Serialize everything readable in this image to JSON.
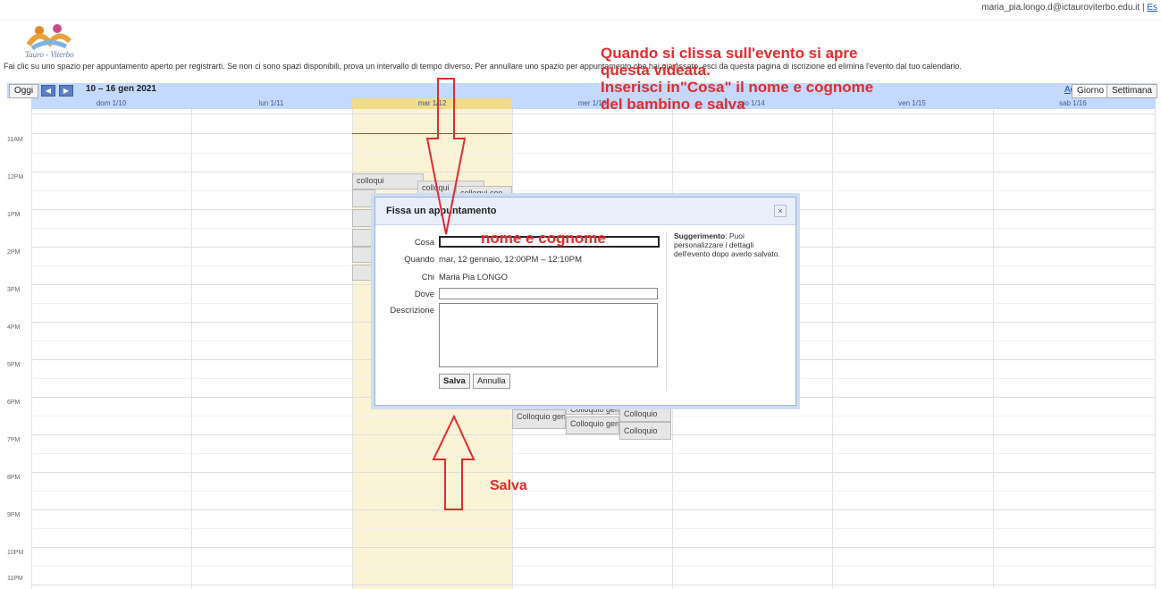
{
  "header": {
    "user_email": "maria_pia.longo.d@ictauroviterbo.edu.it",
    "separator": " | ",
    "exit_link": "Es"
  },
  "instructions": "Fai clic su uno spazio per appuntamento aperto per registrarti. Se non ci sono spazi disponibili, prova un intervallo di tempo diverso. Per annullare uno spazio per appuntamento che hai già fissato, esci da questa pagina di iscrizione ed elimina l'evento dal tuo calendario.",
  "toolbar": {
    "today": "Oggi",
    "prev": "◀",
    "next": "▶",
    "date_range": "10 – 16 gen 2021",
    "refresh": "Aggiorna",
    "view_day": "Giorno",
    "view_week": "Settimana"
  },
  "days": [
    "dom 1/10",
    "lun 1/11",
    "mar 1/12",
    "mer 1/13",
    "gio 1/14",
    "ven 1/15",
    "sab 1/16"
  ],
  "hours": [
    "11AM",
    "12PM",
    "1PM",
    "2PM",
    "3PM",
    "4PM",
    "5PM",
    "6PM",
    "7PM",
    "8PM",
    "9PM",
    "10PM",
    "11PM"
  ],
  "slots": {
    "s1": "colloqui",
    "s2": "colloqui",
    "s3": "colloqui con",
    "s4": "Colloquio gen",
    "s5": "Colloquio gen",
    "s6": "Colloquio gen",
    "s7": "Colloquio",
    "s8": "Colloquio"
  },
  "modal": {
    "title": "Fissa un appuntamento",
    "close": "×",
    "labels": {
      "what": "Cosa",
      "when": "Quando",
      "who": "Chi",
      "where": "Dove",
      "description": "Descrizione"
    },
    "when_value": "mar, 12 gennaio, 12:00PM – 12:10PM",
    "who_value": "Maria Pia LONGO",
    "hint_bold": "Suggerimento",
    "hint_text": ": Puoi personalizzare i dettagli dell'evento dopo averlo salvato.",
    "save": "Salva",
    "cancel": "Annulla"
  },
  "annotations": {
    "line1": "Quando si clissa sull'evento si apre",
    "line2": "questa videata.",
    "line3": "Inserisci in\"Cosa\" il nome e cognome",
    "line4": "del bambino e salva",
    "field_hint": "nome e cognome",
    "save_hint": "Salva"
  },
  "colors": {
    "annotation": "#e32b2b",
    "header_blue": "#c3d9ff",
    "today_bg": "#fbf3d6"
  }
}
